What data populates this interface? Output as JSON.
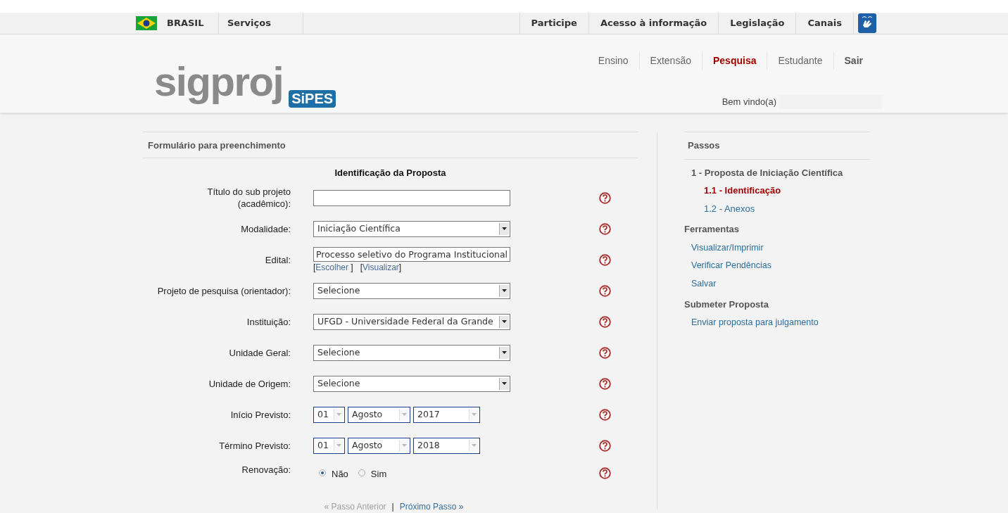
{
  "gov_bar": {
    "left": [
      {
        "label": "BRASIL",
        "kind": "flag"
      },
      {
        "label": "Serviços",
        "kind": "text"
      }
    ],
    "right": [
      "Participe",
      "Acesso à informação",
      "Legislação",
      "Canais"
    ]
  },
  "header": {
    "logo": "sigproj",
    "sublogo": "SiPES",
    "nav": [
      {
        "label": "Ensino",
        "selected": false
      },
      {
        "label": "Extensão",
        "selected": false
      },
      {
        "label": "Pesquisa",
        "selected": true
      },
      {
        "label": "Estudante",
        "selected": false
      },
      {
        "label": "Sair",
        "selected": false
      }
    ],
    "welcome": "Bem vindo(a)"
  },
  "form": {
    "panel_title": "Formulário para preenchimento",
    "section_title": "Identificação da Proposta",
    "fields": [
      {
        "kind": "text",
        "label": "Título do sub projeto (acadêmico):"
      },
      {
        "kind": "select",
        "label": "Modalidade:",
        "value": "Iniciação Científica"
      },
      {
        "kind": "edital",
        "label": "Edital:",
        "value": "Processo seletivo do Programa Institucional",
        "links": [
          {
            "open": "[",
            "label": "Escolher",
            "close": " ]"
          },
          {
            "open": "[",
            "label": "Visualizar",
            "close": "]"
          }
        ]
      },
      {
        "kind": "select",
        "label": "Projeto de pesquisa (orientador):",
        "value": "Selecione"
      },
      {
        "kind": "select",
        "label": "Instituição:",
        "value": "UFGD - Universidade Federal da Grande"
      },
      {
        "kind": "select",
        "label": "Unidade Geral:",
        "value": "Selecione"
      },
      {
        "kind": "select",
        "label": "Unidade de Origem:",
        "value": "Selecione"
      },
      {
        "kind": "date",
        "label": "Início Previsto:",
        "day": "01",
        "month": "Agosto",
        "year": "2017"
      },
      {
        "kind": "date",
        "label": "Término Previsto:",
        "day": "01",
        "month": "Agosto",
        "year": "2018"
      },
      {
        "kind": "radio",
        "label": "Renovação:",
        "options": [
          {
            "label": "Não",
            "selected": true
          },
          {
            "label": "Sim",
            "selected": false
          }
        ]
      }
    ],
    "pager": {
      "previous": {
        "label": "« Passo Anterior",
        "disabled": true
      },
      "separator": "|",
      "next": {
        "label": "Próximo Passo »",
        "disabled": false
      }
    }
  },
  "sidebar": {
    "title": "Passos",
    "step": "1 - Proposta de Iniciação Científica",
    "substeps": [
      {
        "label": "1.1 - Identificação",
        "selected": true
      },
      {
        "label": "1.2 - Anexos",
        "selected": false
      }
    ],
    "groups": [
      {
        "title": "Ferramentas",
        "links": [
          "Visualizar/Imprimir",
          "Verificar Pendências",
          "Salvar"
        ]
      },
      {
        "title": "Submeter Proposta",
        "links": [
          "Enviar proposta para julgamento"
        ]
      }
    ]
  }
}
